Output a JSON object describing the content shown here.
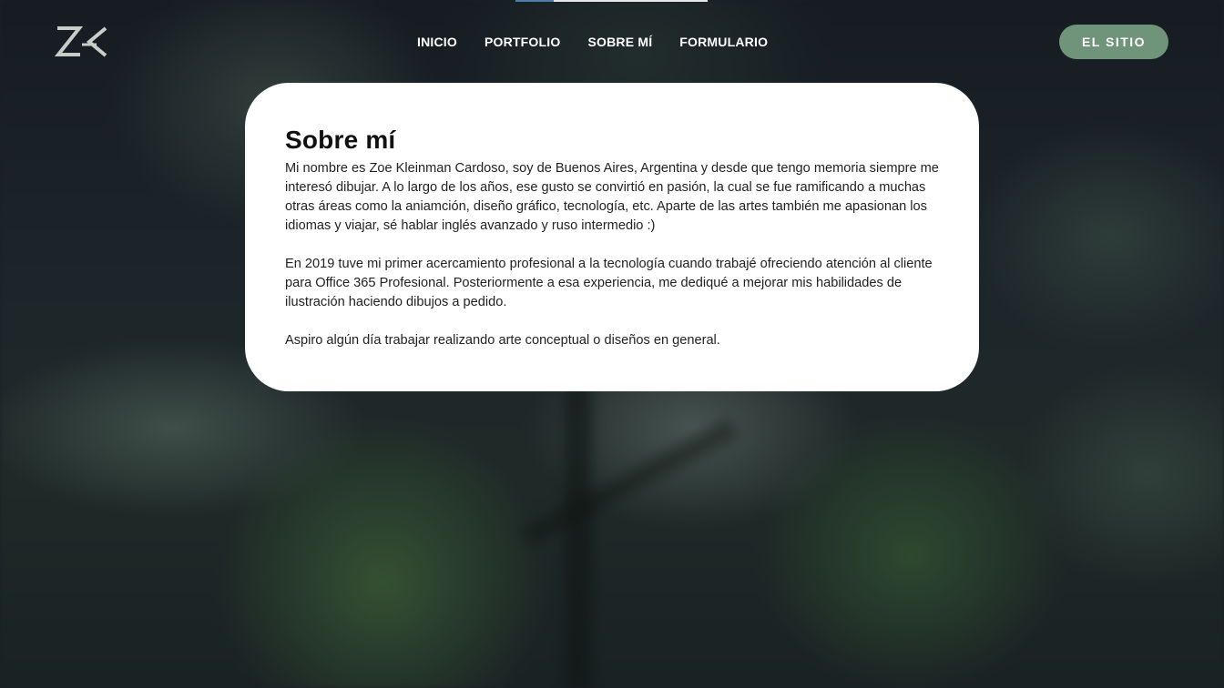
{
  "header": {
    "logo_icon": "zk-monogram-logo",
    "nav": [
      {
        "label": "INICIO"
      },
      {
        "label": "PORTFOLIO"
      },
      {
        "label": "SOBRE MÍ"
      },
      {
        "label": "FORMULARIO"
      }
    ],
    "site_button_label": "EL SITIO"
  },
  "about": {
    "title": "Sobre mí",
    "paragraphs": [
      "Mi nombre es Zoe Kleinman Cardoso, soy de Buenos Aires, Argentina y desde que tengo memoria siempre me interesó dibujar. A lo largo de los años, ese gusto se convirtió en pasión, la cual se fue ramificando a muchas otras áreas como la aniamción, diseño gráfico, tecnología, etc. Aparte de las artes también me apasionan los idiomas y viajar, sé hablar inglés avanzado y ruso intermedio :)",
      "En 2019 tuve mi primer acercamiento profesional a la tecnología cuando trabajé ofreciendo atención al cliente para Office 365 Profesional. Posteriormente a esa experiencia, me dediqué a mejorar mis habilidades de ilustración haciendo dibujos a pedido.",
      "Aspiro algún día trabajar realizando arte conceptual o diseños en general."
    ]
  },
  "colors": {
    "accent": "#6f9479",
    "card_bg": "#ffffff",
    "indicator": "#4c7ea8"
  }
}
